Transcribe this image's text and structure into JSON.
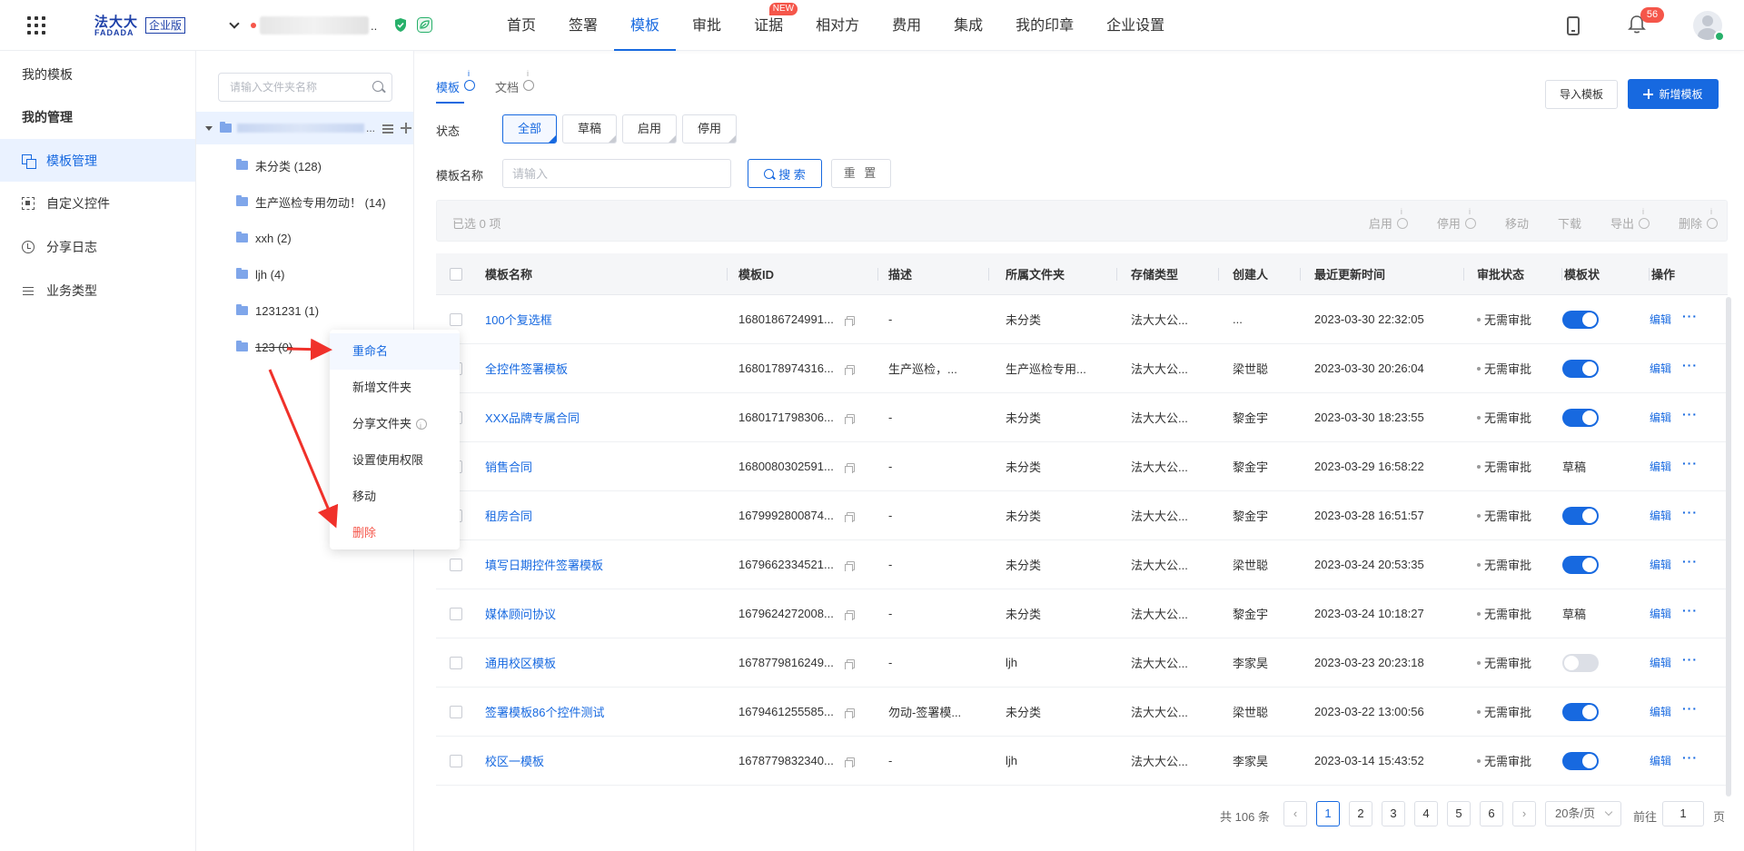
{
  "header": {
    "logo_cn": "法大大",
    "logo_en": "FADADA",
    "logo_edition": "企业版",
    "company_suffix": "..",
    "nav": [
      {
        "label": "首页",
        "active": false
      },
      {
        "label": "签署",
        "active": false
      },
      {
        "label": "模板",
        "active": true
      },
      {
        "label": "审批",
        "active": false
      },
      {
        "label": "证据",
        "active": false,
        "badge": "NEW"
      },
      {
        "label": "相对方",
        "active": false
      },
      {
        "label": "费用",
        "active": false
      },
      {
        "label": "集成",
        "active": false
      },
      {
        "label": "我的印章",
        "active": false
      },
      {
        "label": "企业设置",
        "active": false
      }
    ],
    "notification_count": "56"
  },
  "sidebar": {
    "group1": "我的模板",
    "group2": "我的管理",
    "items": [
      {
        "label": "模板管理",
        "icon": "template-icon",
        "active": true
      },
      {
        "label": "自定义控件",
        "icon": "custom-control-icon",
        "active": false
      },
      {
        "label": "分享日志",
        "icon": "clock-icon",
        "active": false
      },
      {
        "label": "业务类型",
        "icon": "list-icon",
        "active": false
      }
    ]
  },
  "folder_tree": {
    "search_placeholder": "请输入文件夹名称",
    "root_suffix": "...",
    "nodes": [
      {
        "label": "未分类 (128)"
      },
      {
        "label": "生产巡检专用勿动！ (14)"
      },
      {
        "label": "xxh (2)"
      },
      {
        "label": "ljh (4)"
      },
      {
        "label": "1231231 (1)"
      },
      {
        "label": "123 (0)"
      }
    ]
  },
  "context_menu": {
    "items": [
      {
        "label": "重命名"
      },
      {
        "label": "新增文件夹"
      },
      {
        "label": "分享文件夹"
      },
      {
        "label": "设置使用权限"
      },
      {
        "label": "移动"
      },
      {
        "label": "删除"
      }
    ]
  },
  "main": {
    "tabs": [
      {
        "label": "模板",
        "active": true
      },
      {
        "label": "文档",
        "active": false
      }
    ],
    "import_button": "导入模板",
    "new_button": "新增模板",
    "status_label": "状态",
    "status_options": [
      "全部",
      "草稿",
      "启用",
      "停用"
    ],
    "status_selected": "全部",
    "name_label": "模板名称",
    "name_placeholder": "请输入",
    "search_button": "搜 索",
    "reset_button": "重 置",
    "selected_text": "已选  0  项",
    "bulk_actions": [
      {
        "label": "启用",
        "info": true
      },
      {
        "label": "停用",
        "info": true
      },
      {
        "label": "移动",
        "info": false
      },
      {
        "label": "下载",
        "info": false
      },
      {
        "label": "导出",
        "info": true
      },
      {
        "label": "删除",
        "info": true
      }
    ]
  },
  "table": {
    "columns": [
      "模板名称",
      "模板ID",
      "描述",
      "所属文件夹",
      "存储类型",
      "创建人",
      "最近更新时间",
      "审批状态",
      "模板状",
      "操作"
    ],
    "rows": [
      {
        "name": "100个复选框",
        "id": "1680186724991...",
        "desc": "-",
        "folder": "未分类",
        "storage": "法大大公...",
        "creator": "...",
        "updated": "2023-03-30 22:32:05",
        "approval": "无需审批",
        "status": "toggle-on",
        "status_text": "",
        "edit": "编辑",
        "more": "···"
      },
      {
        "name": "全控件签署模板",
        "id": "1680178974316...",
        "desc": "生产巡检，...",
        "folder": "生产巡检专用...",
        "storage": "法大大公...",
        "creator": "梁世聪",
        "updated": "2023-03-30 20:26:04",
        "approval": "无需审批",
        "status": "toggle-on",
        "status_text": "",
        "edit": "编辑",
        "more": "···"
      },
      {
        "name": "XXX品牌专属合同",
        "id": "1680171798306...",
        "desc": "-",
        "folder": "未分类",
        "storage": "法大大公...",
        "creator": "黎金宇",
        "updated": "2023-03-30 18:23:55",
        "approval": "无需审批",
        "status": "toggle-on",
        "status_text": "",
        "edit": "编辑",
        "more": "···"
      },
      {
        "name": "销售合同",
        "id": "1680080302591...",
        "desc": "-",
        "folder": "未分类",
        "storage": "法大大公...",
        "creator": "黎金宇",
        "updated": "2023-03-29 16:58:22",
        "approval": "无需审批",
        "status": "text",
        "status_text": "草稿",
        "edit": "编辑",
        "more": "···"
      },
      {
        "name": "租房合同",
        "id": "1679992800874...",
        "desc": "-",
        "folder": "未分类",
        "storage": "法大大公...",
        "creator": "黎金宇",
        "updated": "2023-03-28 16:51:57",
        "approval": "无需审批",
        "status": "toggle-on",
        "status_text": "",
        "edit": "编辑",
        "more": "···"
      },
      {
        "name": "填写日期控件签署模板",
        "id": "1679662334521...",
        "desc": "-",
        "folder": "未分类",
        "storage": "法大大公...",
        "creator": "梁世聪",
        "updated": "2023-03-24 20:53:35",
        "approval": "无需审批",
        "status": "toggle-on",
        "status_text": "",
        "edit": "编辑",
        "more": "···"
      },
      {
        "name": "媒体顾问协议",
        "id": "1679624272008...",
        "desc": "-",
        "folder": "未分类",
        "storage": "法大大公...",
        "creator": "黎金宇",
        "updated": "2023-03-24 10:18:27",
        "approval": "无需审批",
        "status": "text",
        "status_text": "草稿",
        "edit": "编辑",
        "more": "···"
      },
      {
        "name": "通用校区模板",
        "id": "1678779816249...",
        "desc": "-",
        "folder": "ljh",
        "storage": "法大大公...",
        "creator": "李家昊",
        "updated": "2023-03-23 20:23:18",
        "approval": "无需审批",
        "status": "toggle-off",
        "status_text": "",
        "edit": "编辑",
        "more": "···"
      },
      {
        "name": "签署模板86个控件测试",
        "id": "1679461255585...",
        "desc": "勿动-签署模...",
        "folder": "未分类",
        "storage": "法大大公...",
        "creator": "梁世聪",
        "updated": "2023-03-22 13:00:56",
        "approval": "无需审批",
        "status": "toggle-on",
        "status_text": "",
        "edit": "编辑",
        "more": "···"
      },
      {
        "name": "校区一模板",
        "id": "1678779832340...",
        "desc": "-",
        "folder": "ljh",
        "storage": "法大大公...",
        "creator": "李家昊",
        "updated": "2023-03-14 15:43:52",
        "approval": "无需审批",
        "status": "toggle-on",
        "status_text": "",
        "edit": "编辑",
        "more": "···"
      }
    ]
  },
  "pagination": {
    "total": "共 106 条",
    "pages": [
      "1",
      "2",
      "3",
      "4",
      "5",
      "6"
    ],
    "current": "1",
    "page_size": "20条/页",
    "goto_label": "前往",
    "goto_value": "1",
    "page_suffix": "页"
  },
  "colors": {
    "accent": "#1769e0",
    "danger": "#f5564a",
    "annotation_arrow": "#f0312a"
  }
}
